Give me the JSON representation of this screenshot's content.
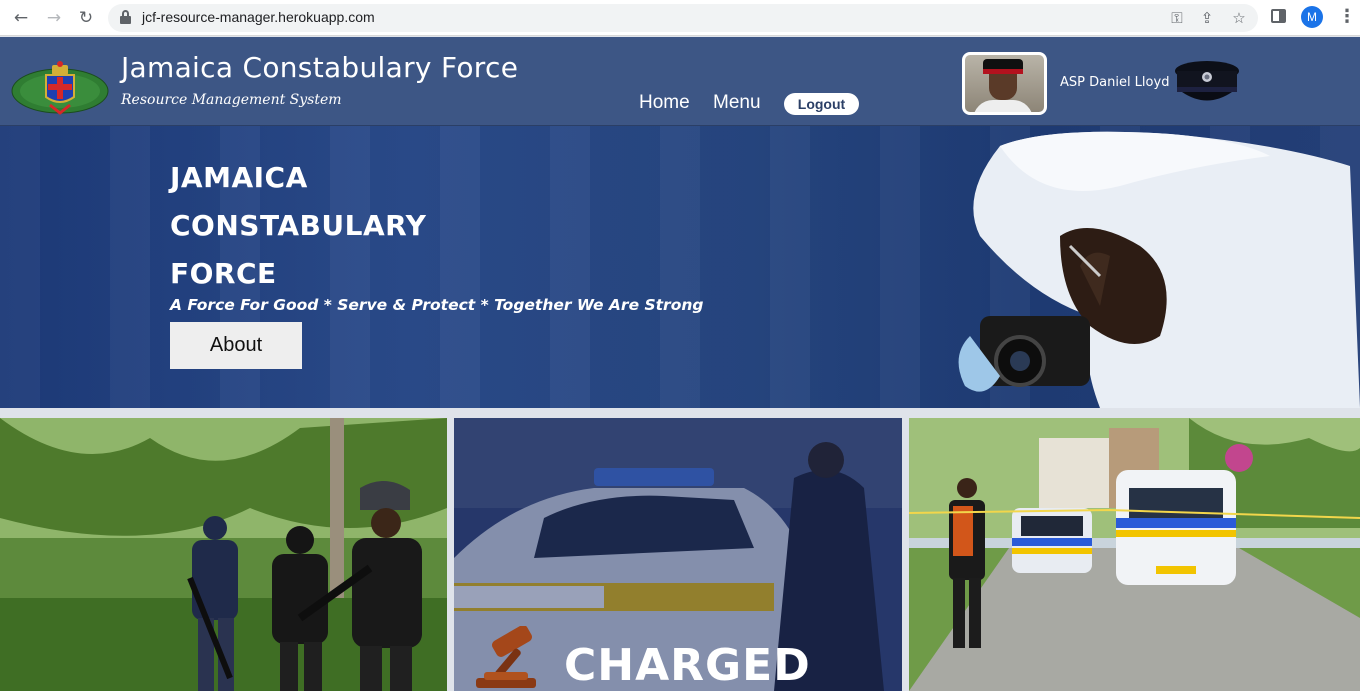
{
  "browser": {
    "url": "jcf-resource-manager.herokuapp.com",
    "profile_initial": "M",
    "icons": [
      "back-arrow-icon",
      "forward-arrow-icon",
      "reload-icon",
      "lock-icon",
      "key-icon",
      "share-icon",
      "star-icon",
      "side-panel-icon",
      "kebab-menu-icon"
    ]
  },
  "header": {
    "title": "Jamaica Constabulary Force",
    "subtitle": "Resource Management System",
    "nav": {
      "home": "Home",
      "menu": "Menu",
      "logout": "Logout"
    },
    "user": {
      "name": "ASP Daniel Lloyd"
    }
  },
  "hero": {
    "heading_line1": "JAMAICA",
    "heading_line2": "CONSTABULARY",
    "heading_line3": "FORCE",
    "motto": "A Force For Good * Serve & Protect * Together We Are Strong",
    "about_label": "About"
  },
  "tiles": {
    "charged_label": "CHARGED"
  },
  "colors": {
    "header_bg": "#3d5685",
    "hero_bg": "#23427e",
    "page_bg": "#dfe3ea"
  }
}
